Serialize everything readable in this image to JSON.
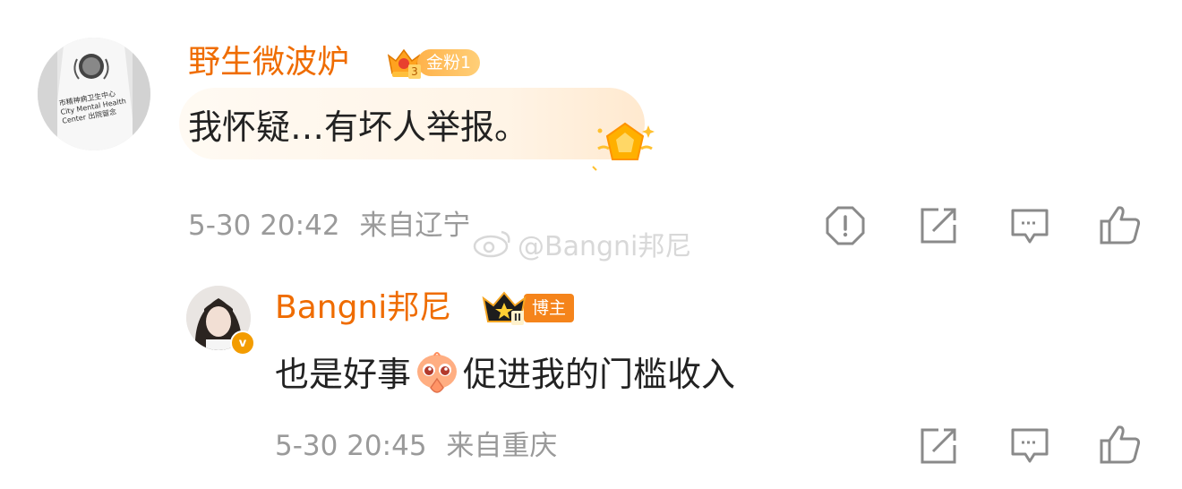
{
  "comment": {
    "username": "野生微波炉",
    "badge_level": "3",
    "badge_label": "金粉1",
    "text": "我怀疑…有坏人举报。",
    "timestamp": "5-30 20:42",
    "location": "来自辽宁",
    "avatar_text": "市精神病卫生中心 City Mental Health Center 出院留念",
    "actions": [
      "report-icon",
      "share-icon",
      "comment-icon",
      "like-icon"
    ]
  },
  "reply": {
    "username": "Bangni邦尼",
    "badge_level": "II",
    "badge_label": "博主",
    "verified_mark": "v",
    "text_before": "也是好事",
    "text_after": "促进我的门槛收入",
    "emoji": "praying-emoji",
    "timestamp": "5-30 20:45",
    "location": "来自重庆",
    "actions": [
      "share-icon",
      "comment-icon",
      "like-icon"
    ]
  },
  "watermark": {
    "text": "@Bangni邦尼"
  },
  "colors": {
    "username": "#ef6c00",
    "meta": "#9a9a9a",
    "badge_gold": "#ffb24a",
    "badge_orange": "#f5841b"
  }
}
